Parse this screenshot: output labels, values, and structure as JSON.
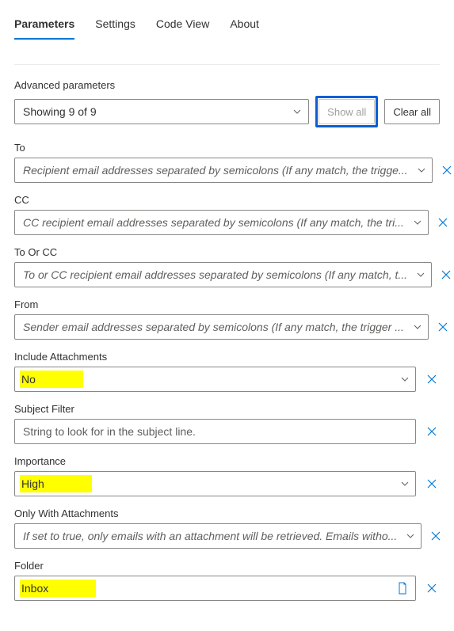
{
  "tabs": [
    {
      "label": "Parameters",
      "active": true
    },
    {
      "label": "Settings",
      "active": false
    },
    {
      "label": "Code View",
      "active": false
    },
    {
      "label": "About",
      "active": false
    }
  ],
  "advanced": {
    "label": "Advanced parameters",
    "showing_text": "Showing 9 of 9",
    "show_all_label": "Show all",
    "clear_all_label": "Clear all"
  },
  "fields": {
    "to": {
      "label": "To",
      "placeholder": "Recipient email addresses separated by semicolons (If any match, the trigge..."
    },
    "cc": {
      "label": "CC",
      "placeholder": "CC recipient email addresses separated by semicolons (If any match, the tri..."
    },
    "to_or_cc": {
      "label": "To Or CC",
      "placeholder": "To or CC recipient email addresses separated by semicolons (If any match, t..."
    },
    "from": {
      "label": "From",
      "placeholder": "Sender email addresses separated by semicolons (If any match, the trigger ..."
    },
    "include_attachments": {
      "label": "Include Attachments",
      "value": "No"
    },
    "subject_filter": {
      "label": "Subject Filter",
      "placeholder": "String to look for in the subject line."
    },
    "importance": {
      "label": "Importance",
      "value": "High"
    },
    "only_with_attachments": {
      "label": "Only With Attachments",
      "placeholder": "If set to true, only emails with an attachment will be retrieved. Emails witho..."
    },
    "folder": {
      "label": "Folder",
      "value": "Inbox"
    }
  }
}
